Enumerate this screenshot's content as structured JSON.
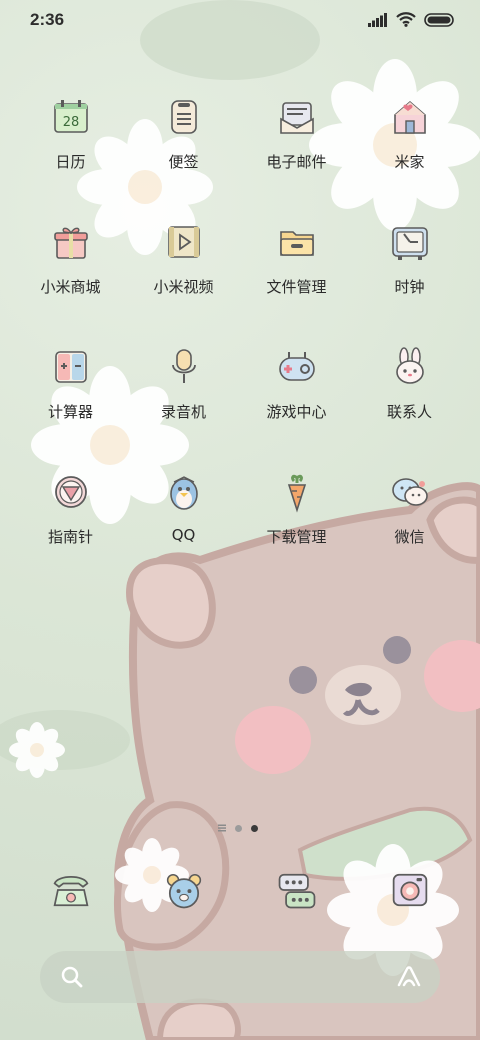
{
  "status_bar": {
    "time": "2:36",
    "icons": [
      "signal-icon",
      "wifi-icon",
      "battery-icon"
    ]
  },
  "apps": [
    {
      "label": "日历",
      "icon": "calendar-icon",
      "date": "28"
    },
    {
      "label": "便签",
      "icon": "notes-icon"
    },
    {
      "label": "电子邮件",
      "icon": "email-icon"
    },
    {
      "label": "米家",
      "icon": "home-icon"
    },
    {
      "label": "小米商城",
      "icon": "gift-icon"
    },
    {
      "label": "小米视频",
      "icon": "video-icon"
    },
    {
      "label": "文件管理",
      "icon": "folder-icon"
    },
    {
      "label": "时钟",
      "icon": "clock-icon"
    },
    {
      "label": "计算器",
      "icon": "calculator-icon"
    },
    {
      "label": "录音机",
      "icon": "microphone-icon"
    },
    {
      "label": "游戏中心",
      "icon": "gamepad-icon"
    },
    {
      "label": "联系人",
      "icon": "bunny-icon"
    },
    {
      "label": "指南针",
      "icon": "compass-icon"
    },
    {
      "label": "QQ",
      "icon": "penguin-icon"
    },
    {
      "label": "下载管理",
      "icon": "carrot-icon"
    },
    {
      "label": "微信",
      "icon": "chat-bubbles-icon"
    }
  ],
  "page_indicator": {
    "count": 3,
    "active": 3
  },
  "dock": [
    {
      "icon": "phone-icon"
    },
    {
      "icon": "bear-icon"
    },
    {
      "icon": "messages-icon"
    },
    {
      "icon": "camera-icon"
    }
  ],
  "search": {
    "icon": "search-icon",
    "assistant_icon": "assistant-icon"
  },
  "colors": {
    "label": "#2b2b2b",
    "background": "#dbe6d6",
    "bear": "#d9c2bb",
    "bear_outline": "#c9aaa3"
  }
}
